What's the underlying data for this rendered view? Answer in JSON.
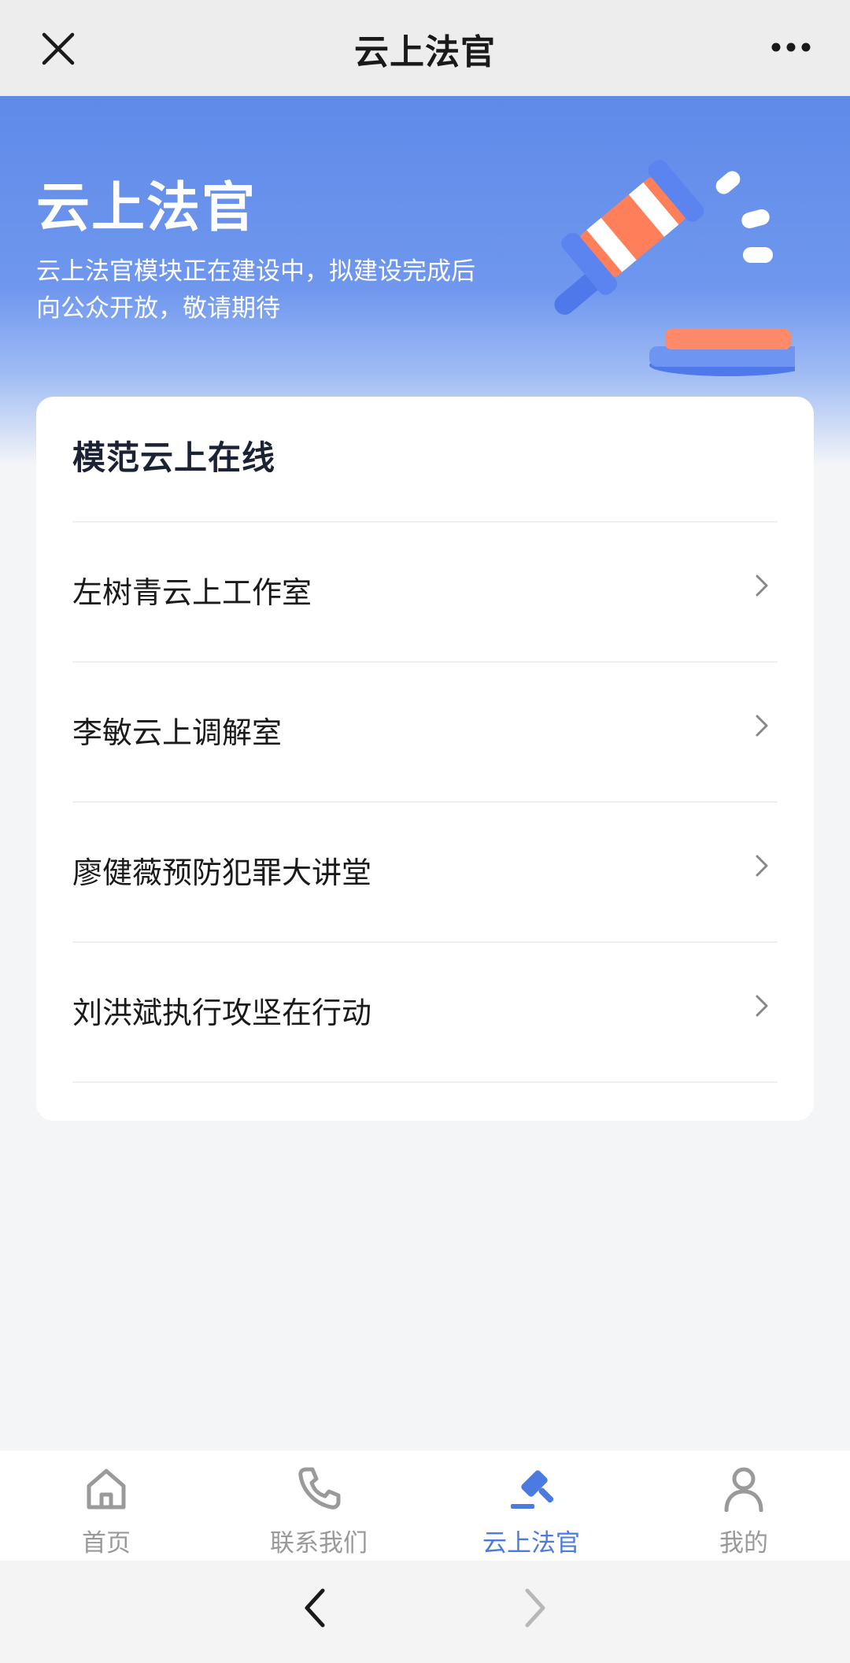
{
  "topbar": {
    "title": "云上法官"
  },
  "hero": {
    "title": "云上法官",
    "description": "云上法官模块正在建设中，拟建设完成后向公众开放，敬请期待"
  },
  "card": {
    "title": "模范云上在线",
    "items": [
      {
        "label": "左树青云上工作室"
      },
      {
        "label": "李敏云上调解室"
      },
      {
        "label": "廖健薇预防犯罪大讲堂"
      },
      {
        "label": "刘洪斌执行攻坚在行动"
      }
    ]
  },
  "tabbar": {
    "items": [
      {
        "label": "首页",
        "icon": "home-icon",
        "active": false
      },
      {
        "label": "联系我们",
        "icon": "phone-icon",
        "active": false
      },
      {
        "label": "云上法官",
        "icon": "gavel-icon",
        "active": true
      },
      {
        "label": "我的",
        "icon": "user-icon",
        "active": false
      }
    ]
  },
  "colors": {
    "accent": "#4c7be0",
    "hero_blue": "#5f8ae8",
    "inactive": "#999999"
  }
}
